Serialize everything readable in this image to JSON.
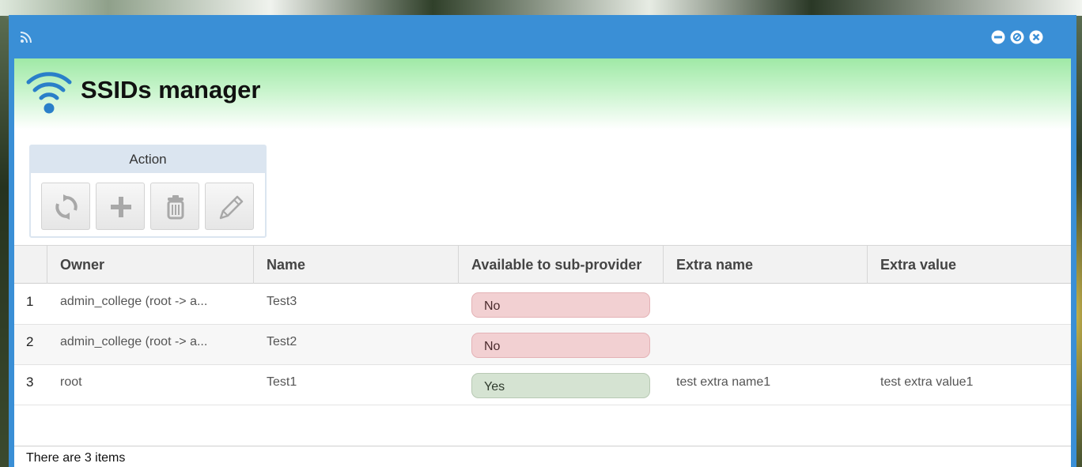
{
  "window": {
    "title": "",
    "page_title": "SSIDs manager"
  },
  "icons": {
    "titlebar": "rss-icon",
    "header": "wifi-icon",
    "minimize": "minimize-icon",
    "maximize": "restore-icon",
    "close": "close-icon"
  },
  "actions": {
    "header": "Action",
    "buttons": [
      {
        "name": "refresh",
        "icon": "refresh-icon"
      },
      {
        "name": "add",
        "icon": "plus-icon"
      },
      {
        "name": "delete",
        "icon": "trash-icon"
      },
      {
        "name": "edit",
        "icon": "pencil-icon"
      }
    ]
  },
  "grid": {
    "columns": [
      "Owner",
      "Name",
      "Available to sub-provider",
      "Extra name",
      "Extra value"
    ],
    "rows": [
      {
        "num": "1",
        "owner": "admin_college (root -> a...",
        "name": "Test3",
        "available": "No",
        "extra_name": "",
        "extra_value": ""
      },
      {
        "num": "2",
        "owner": "admin_college (root -> a...",
        "name": "Test2",
        "available": "No",
        "extra_name": "",
        "extra_value": ""
      },
      {
        "num": "3",
        "owner": "root",
        "name": "Test1",
        "available": "Yes",
        "extra_name": "test extra name1",
        "extra_value": "test extra value1"
      }
    ]
  },
  "footer": {
    "status": "There are 3 items"
  },
  "colors": {
    "titlebar": "#3a8fd6",
    "badge_no": "#f2d0d2",
    "badge_yes": "#d5e3d2",
    "header_gradient": "#9fe9a6"
  }
}
